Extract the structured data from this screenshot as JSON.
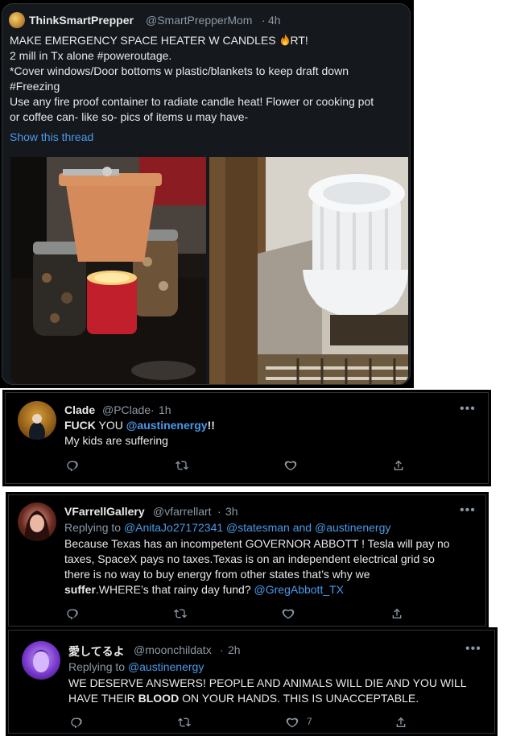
{
  "colors": {
    "background": "#000000",
    "card": "#15181c",
    "text": "#e7e9ea",
    "muted": "#8b98a5",
    "link": "#4a99e9"
  },
  "tweet1": {
    "name": "ThinkSmartPrepper",
    "handle": "@SmartPrepperMom",
    "time": "4h",
    "lines": [
      "MAKE EMERGENCY SPACE HEATER W CANDLES",
      "RT!",
      "2 mill in Tx alone #poweroutage.",
      "*Cover windows/Door bottoms w plastic/blankets to keep draft down",
      "#Freezing",
      "Use any fire proof container to radiate candle heat! Flower or cooking pot",
      "or coffee can- like so- pics of items u may have-"
    ],
    "show_thread": "Show this thread",
    "fire_icon": "fire-emoji"
  },
  "tweet2": {
    "name": "Clade",
    "handle": "@PClade",
    "time": "1h",
    "line1_bold": "FUCK",
    "line1_mid": " YOU ",
    "line1_mention": "@austinenergy",
    "line1_end": "!!",
    "line2": "My kids are suffering"
  },
  "tweet3": {
    "name": "VFarrellGallery",
    "handle": "@vfarrellart",
    "time": "3h",
    "replying_label": "Replying to",
    "replying_1": "@AnitaJo27172341",
    "replying_2": "@statesman",
    "replying_and": "and",
    "replying_3": "@austinenergy",
    "line1": "Because Texas has an incompetent GOVERNOR ABBOTT ! Tesla will pay no",
    "line2": "taxes, SpaceX pays no taxes.Texas is on an independent electrical grid so",
    "line3": "there is no way to buy energy from other states that’s why we",
    "line4_bold": "suffer",
    "line4_mid": ".WHERE’s that rainy day fund? ",
    "line4_mention": "@GregAbbott_TX"
  },
  "tweet4": {
    "name": "愛してるよ",
    "handle": "@moonchildatx",
    "time": "2h",
    "replying_label": "Replying to",
    "replying_1": "@austinenergy",
    "line1": "WE DESERVE ANSWERS! PEOPLE AND ANIMALS WILL DIE AND YOU WILL",
    "line2_a": "HAVE THEIR ",
    "line2_bold": "BLOOD",
    "line2_b": " ON YOUR HANDS. THIS IS UNACCEPTABLE.",
    "like_count": "7"
  },
  "more_glyph": "•••",
  "dot": "·"
}
